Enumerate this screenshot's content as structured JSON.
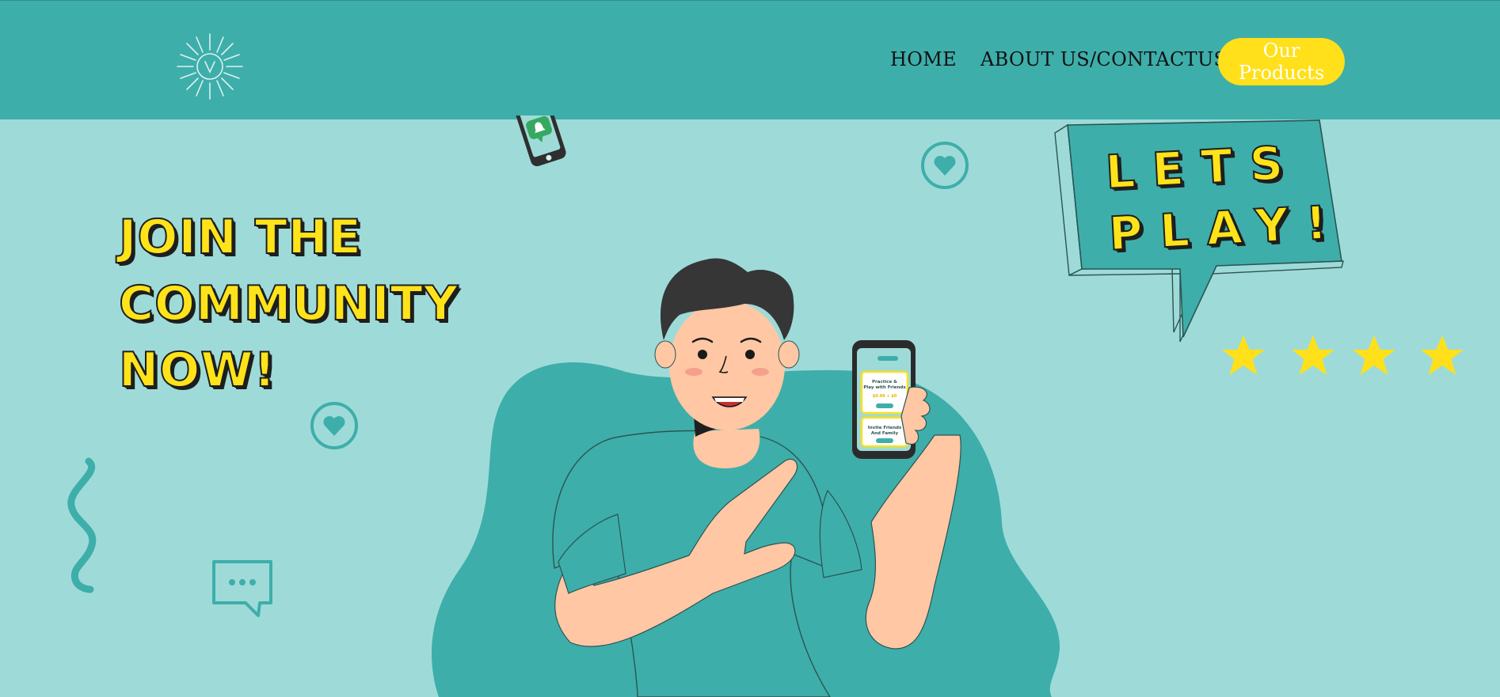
{
  "nav": {
    "logo": "logo-emblem",
    "links": [
      "HOME",
      "ABOUT US/CONTACTUS"
    ],
    "cta_label": "Our Products"
  },
  "hero": {
    "headline_lines": [
      "JOIN THE",
      "COMMUNITY",
      "NOW!"
    ],
    "bubble_lines": [
      "LETS",
      "PLAY!"
    ],
    "star_count": 4
  },
  "phone_screen": {
    "card1_title": "Practice &",
    "card1_sub": "Play with Friends",
    "card1_price": "$0.99 + $0",
    "card2_title": "Invite Friends",
    "card2_sub": "And Family"
  },
  "colors": {
    "background": "#9edbd8",
    "navbar": "#3eaeaa",
    "accent_yellow": "#ffe01a",
    "teal_dark": "#3eaeaa",
    "skin": "#ffc7a3",
    "hair": "#363636"
  },
  "icons": [
    "heart-circle-icon",
    "chat-bubble-icon",
    "squiggle-decoration",
    "phone-notification-icon",
    "star-icon"
  ]
}
